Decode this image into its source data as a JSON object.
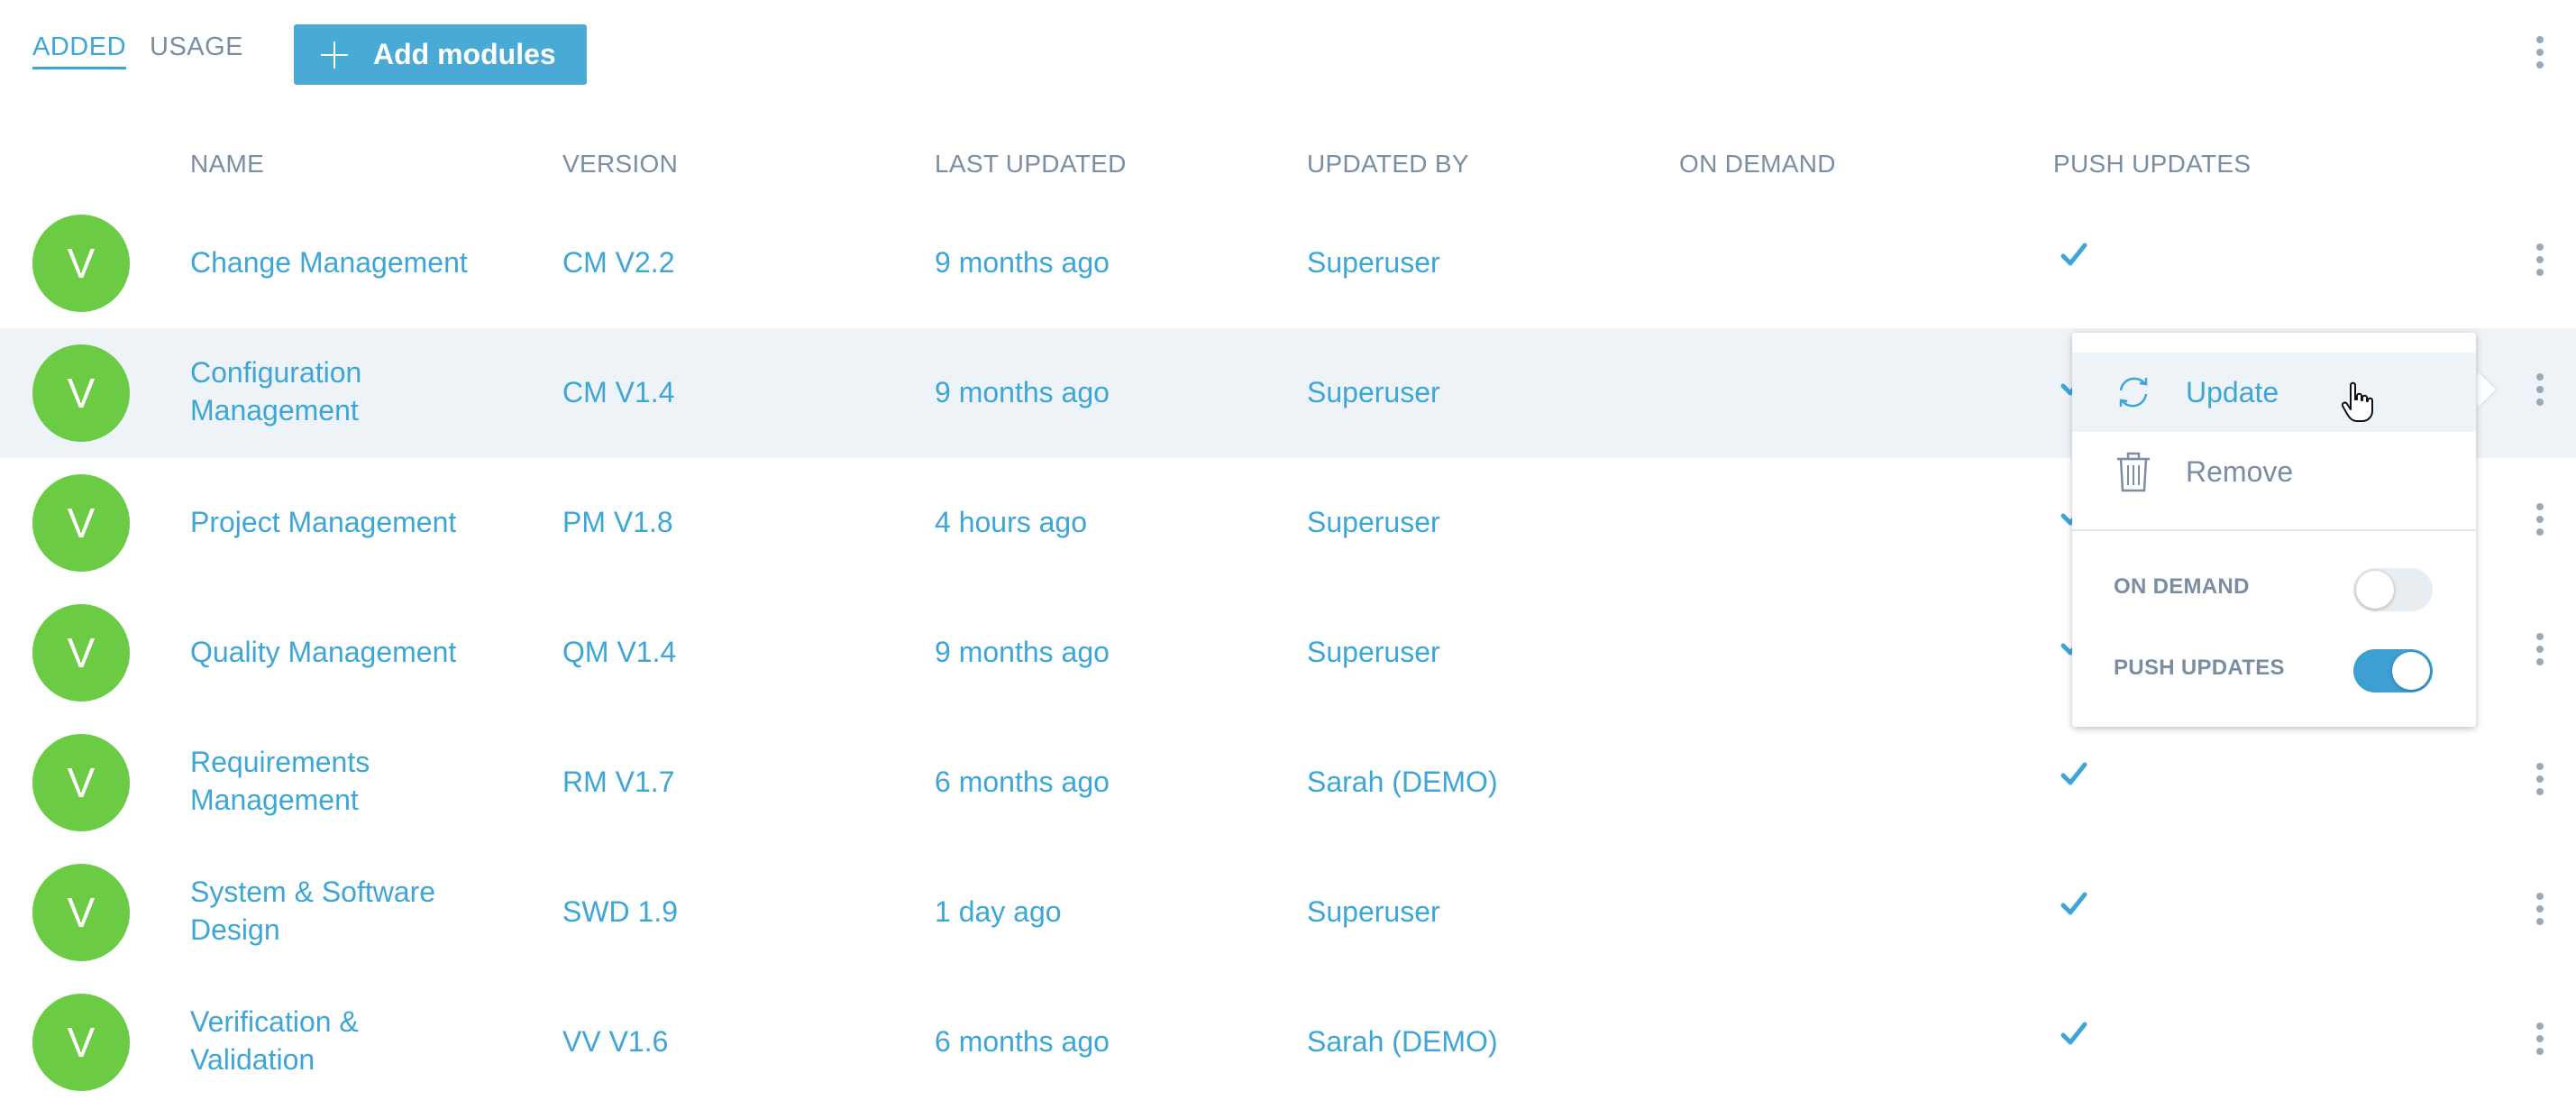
{
  "tabs": [
    {
      "label": "ADDED",
      "active": true
    },
    {
      "label": "USAGE",
      "active": false
    }
  ],
  "add_button": {
    "label": "Add modules",
    "icon": "plus-icon"
  },
  "columns": [
    "NAME",
    "VERSION",
    "LAST UPDATED",
    "UPDATED BY",
    "ON DEMAND",
    "PUSH UPDATES"
  ],
  "rows": [
    {
      "avatar": "V",
      "name": "Change Management",
      "version": "CM V2.2",
      "last_updated": "9 months ago",
      "updated_by": "Superuser",
      "push_updates": true
    },
    {
      "avatar": "V",
      "name": "Configuration Management",
      "version": "CM V1.4",
      "last_updated": "9 months ago",
      "updated_by": "Superuser",
      "push_updates": true
    },
    {
      "avatar": "V",
      "name": "Project Management",
      "version": "PM V1.8",
      "last_updated": "4 hours ago",
      "updated_by": "Superuser",
      "push_updates": true
    },
    {
      "avatar": "V",
      "name": "Quality Management",
      "version": "QM V1.4",
      "last_updated": "9 months ago",
      "updated_by": "Superuser",
      "push_updates": true
    },
    {
      "avatar": "V",
      "name": "Requirements Management",
      "version": "RM V1.7",
      "last_updated": "6 months ago",
      "updated_by": "Sarah (DEMO)",
      "push_updates": true
    },
    {
      "avatar": "V",
      "name": "System & Software Design",
      "version": "SWD 1.9",
      "last_updated": "1 day ago",
      "updated_by": "Superuser",
      "push_updates": true
    },
    {
      "avatar": "V",
      "name": "Verification & Validation",
      "version": "VV V1.6",
      "last_updated": "6 months ago",
      "updated_by": "Sarah (DEMO)",
      "push_updates": true
    }
  ],
  "popup": {
    "update_label": "Update",
    "remove_label": "Remove",
    "on_demand_label": "ON DEMAND",
    "on_demand": false,
    "push_updates_label": "PUSH UPDATES",
    "push_updates": true
  },
  "colors": {
    "accent": "#3ea6d6",
    "button": "#4aaad6",
    "avatar": "#6bcb45",
    "muted": "#7a8ea3",
    "row_highlight": "#eef3f8"
  }
}
